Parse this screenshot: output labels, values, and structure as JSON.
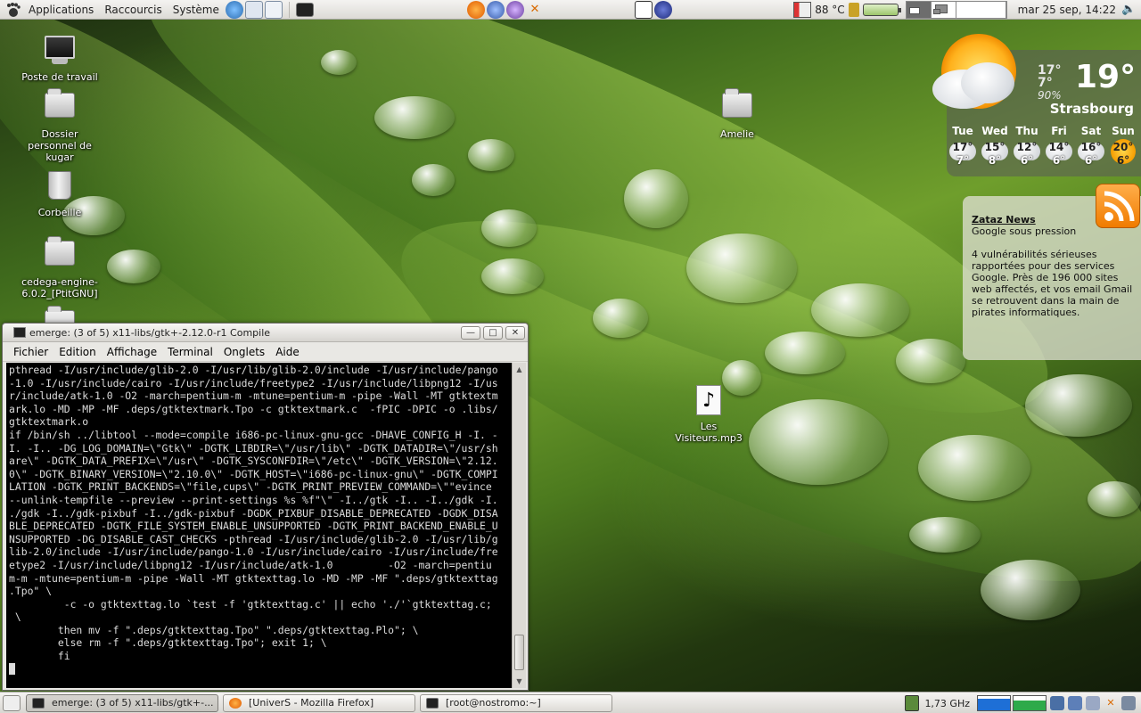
{
  "top_panel": {
    "menus": [
      "Applications",
      "Raccourcis",
      "Système"
    ],
    "temperature": "88 °C",
    "clock": "mar 25 sep, 14:22"
  },
  "desktop_icons": {
    "computer": "Poste de travail",
    "home": "Dossier personnel de kugar",
    "trash": "Corbeille",
    "cedega": "cedega-engine-6.0.2_[PtitGNU]",
    "amelie": "Amelie",
    "music": "Les Visiteurs.mp3"
  },
  "weather": {
    "current_high": "17°",
    "current_low": "7°",
    "humidity": "90%",
    "temperature": "19°",
    "city": "Strasbourg",
    "forecast": [
      {
        "day": "Tue",
        "high": "17°",
        "low": "7°",
        "icon": "cloudy-icon"
      },
      {
        "day": "Wed",
        "high": "15°",
        "low": "8°",
        "icon": "cloudy-icon"
      },
      {
        "day": "Thu",
        "high": "12°",
        "low": "6°",
        "icon": "rain-icon"
      },
      {
        "day": "Fri",
        "high": "14°",
        "low": "6°",
        "icon": "rain-icon"
      },
      {
        "day": "Sat",
        "high": "16°",
        "low": "6°",
        "icon": "rain-icon"
      },
      {
        "day": "Sun",
        "high": "20°",
        "low": "6°",
        "icon": "sun-icon"
      }
    ]
  },
  "news": {
    "source": "Zataz News",
    "headline": "Google sous pression",
    "body": "4 vulnérabilités sérieuses rapportées pour des services Google. Près de 196 000 sites web affectés, et vos email Gmail se retrouvent dans la main de pirates informatiques."
  },
  "terminal": {
    "title": "emerge: (3 of 5) x11-libs/gtk+-2.12.0-r1 Compile",
    "menu": [
      "Fichier",
      "Edition",
      "Affichage",
      "Terminal",
      "Onglets",
      "Aide"
    ],
    "lines": [
      "pthread -I/usr/include/glib-2.0 -I/usr/lib/glib-2.0/include -I/usr/include/pango",
      "-1.0 -I/usr/include/cairo -I/usr/include/freetype2 -I/usr/include/libpng12 -I/us",
      "r/include/atk-1.0 -O2 -march=pentium-m -mtune=pentium-m -pipe -Wall -MT gtktextm",
      "ark.lo -MD -MP -MF .deps/gtktextmark.Tpo -c gtktextmark.c  -fPIC -DPIC -o .libs/",
      "gtktextmark.o",
      "if /bin/sh ../libtool --mode=compile i686-pc-linux-gnu-gcc -DHAVE_CONFIG_H -I. -",
      "I. -I.. -DG_LOG_DOMAIN=\\\"Gtk\\\" -DGTK_LIBDIR=\\\"/usr/lib\\\" -DGTK_DATADIR=\\\"/usr/sh",
      "are\\\" -DGTK_DATA_PREFIX=\\\"/usr\\\" -DGTK_SYSCONFDIR=\\\"/etc\\\" -DGTK_VERSION=\\\"2.12.",
      "0\\\" -DGTK_BINARY_VERSION=\\\"2.10.0\\\" -DGTK_HOST=\\\"i686-pc-linux-gnu\\\" -DGTK_COMPI",
      "LATION -DGTK_PRINT_BACKENDS=\\\"file,cups\\\" -DGTK_PRINT_PREVIEW_COMMAND=\\\"\"evince",
      "--unlink-tempfile --preview --print-settings %s %f\"\\\" -I../gtk -I.. -I../gdk -I.",
      "./gdk -I../gdk-pixbuf -I../gdk-pixbuf -DGDK_PIXBUF_DISABLE_DEPRECATED -DGDK_DISA",
      "BLE_DEPRECATED -DGTK_FILE_SYSTEM_ENABLE_UNSUPPORTED -DGTK_PRINT_BACKEND_ENABLE_U",
      "NSUPPORTED -DG_DISABLE_CAST_CHECKS -pthread -I/usr/include/glib-2.0 -I/usr/lib/g",
      "lib-2.0/include -I/usr/include/pango-1.0 -I/usr/include/cairo -I/usr/include/fre",
      "etype2 -I/usr/include/libpng12 -I/usr/include/atk-1.0         -O2 -march=pentiu",
      "m-m -mtune=pentium-m -pipe -Wall -MT gtktexttag.lo -MD -MP -MF \".deps/gtktexttag",
      ".Tpo\" \\",
      "         -c -o gtktexttag.lo `test -f 'gtktexttag.c' || echo './'`gtktexttag.c;",
      " \\",
      "        then mv -f \".deps/gtktexttag.Tpo\" \".deps/gtktexttag.Plo\"; \\",
      "        else rm -f \".deps/gtktexttag.Tpo\"; exit 1; \\",
      "        fi"
    ]
  },
  "taskbar": {
    "tasks": [
      {
        "label": "emerge: (3 of 5) x11-libs/gtk+-...",
        "icon": "terminal-icon"
      },
      {
        "label": "[UniverS - Mozilla Firefox]",
        "icon": "firefox-icon"
      },
      {
        "label": "[root@nostromo:~]",
        "icon": "terminal-icon"
      }
    ],
    "cpu_freq": "1,73 GHz"
  }
}
